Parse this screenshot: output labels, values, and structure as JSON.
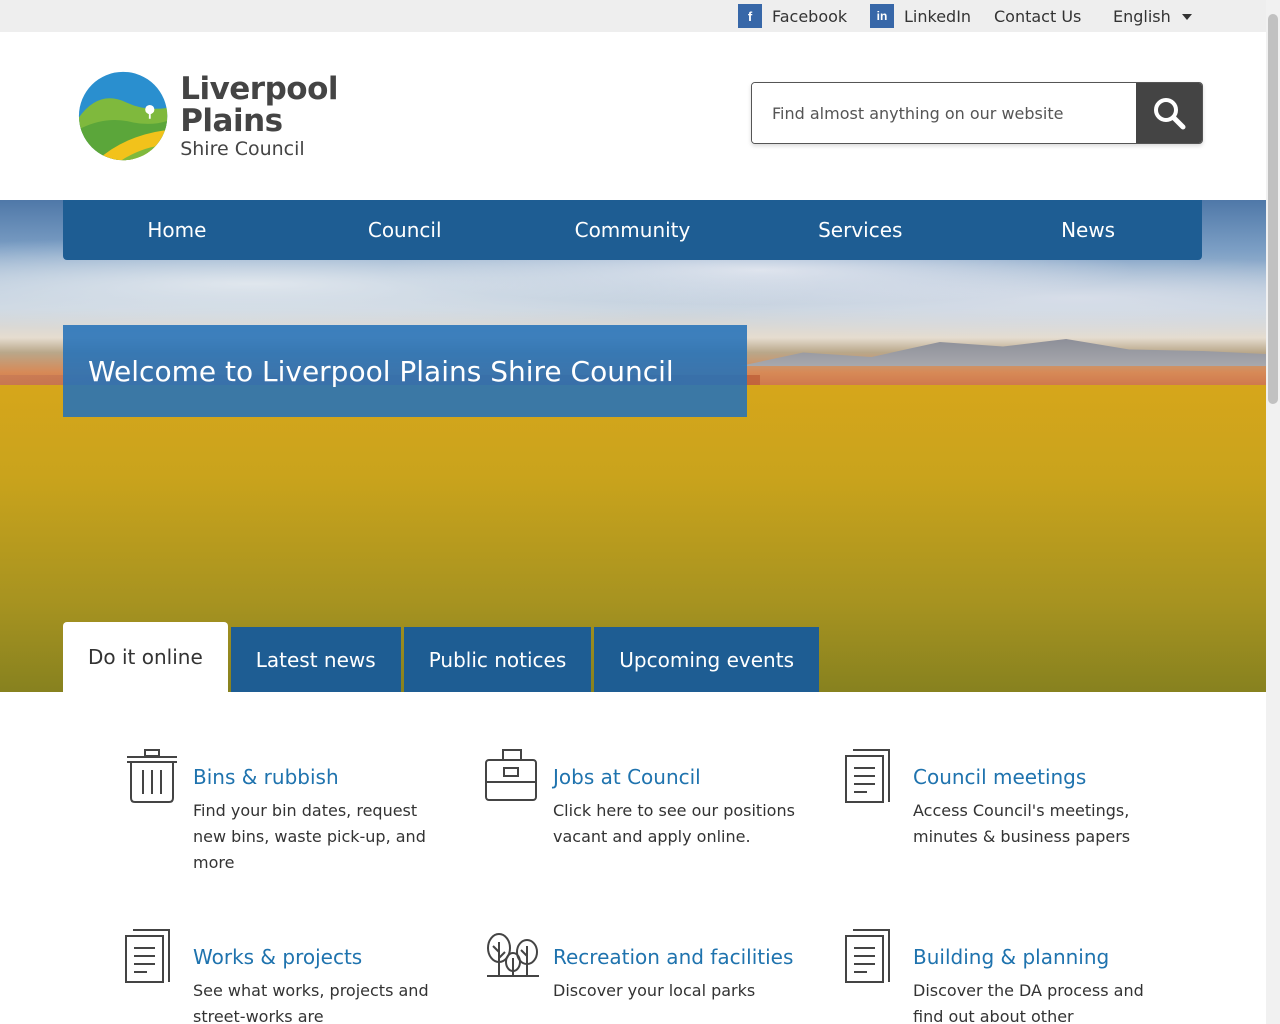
{
  "topbar": {
    "facebook": {
      "label": "Facebook",
      "icon": "f"
    },
    "linkedin": {
      "label": "LinkedIn",
      "icon": "in"
    },
    "contact": "Contact Us",
    "language": "English"
  },
  "logo": {
    "line1": "Liverpool",
    "line2": "Plains",
    "line3": "Shire Council"
  },
  "search": {
    "placeholder": "Find almost anything on our website",
    "icon": "search-icon"
  },
  "nav": [
    "Home",
    "Council",
    "Community",
    "Services",
    "News"
  ],
  "hero": {
    "title": "Welcome to Liverpool Plains Shire Council"
  },
  "tabs": [
    {
      "label": "Do it online",
      "active": true
    },
    {
      "label": "Latest news",
      "active": false
    },
    {
      "label": "Public notices",
      "active": false
    },
    {
      "label": "Upcoming events",
      "active": false
    }
  ],
  "cards": [
    {
      "title": "Bins & rubbish",
      "text": "Find your bin dates, request new bins, waste pick-up, and more",
      "icon": "bin-icon"
    },
    {
      "title": "Jobs at Council",
      "text": "Click here to see our positions vacant and apply online.",
      "icon": "briefcase-icon"
    },
    {
      "title": "Council meetings",
      "text": "Access Council's meetings, minutes & business papers",
      "icon": "document-icon"
    },
    {
      "title": "Works & projects",
      "text": "See what works, projects and street-works are",
      "icon": "document-icon"
    },
    {
      "title": "Recreation and facilities",
      "text": "Discover your local parks",
      "icon": "trees-icon"
    },
    {
      "title": "Building & planning",
      "text": "Discover the DA process and find out about other",
      "icon": "document-icon"
    }
  ],
  "colors": {
    "nav": "#1e5d93",
    "link": "#1f73ae",
    "welcome": "#2572b8"
  }
}
